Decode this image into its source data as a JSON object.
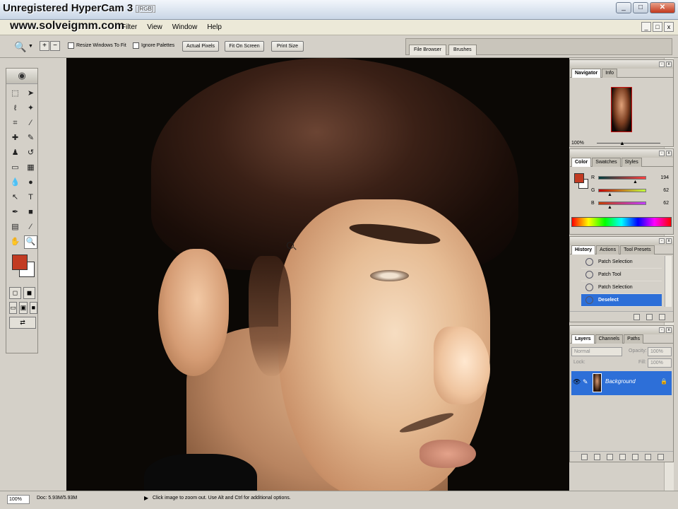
{
  "window": {
    "title": "Unregistered HyperCam 3",
    "mode": "[RGB]",
    "watermark": "www.solveigmm.com",
    "buttons": [
      "_",
      "□",
      "✕"
    ]
  },
  "menubar": {
    "items": [
      "Filter",
      "View",
      "Window",
      "Help"
    ],
    "doc_buttons": [
      "_",
      "□",
      "x"
    ]
  },
  "options_bar": {
    "tool_icon": "zoom-icon",
    "checkbox_resize": "Resize Windows To Fit",
    "checkbox_ignore": "Ignore Palettes",
    "btn_actual": "Actual Pixels",
    "btn_fit": "Fit On Screen",
    "btn_print": "Print Size",
    "palette_tabs": [
      "File Browser",
      "Brushes"
    ]
  },
  "navigator": {
    "tabs": [
      "Navigator",
      "Info"
    ],
    "zoom": "100%"
  },
  "color": {
    "tabs": [
      "Color",
      "Swatches",
      "Styles"
    ],
    "fg_color": "#c23b22",
    "bg_color": "#ffffff",
    "channels": [
      {
        "label": "R",
        "value": "194",
        "gradient": "linear-gradient(to right, #003e3e, #ff3e3e)",
        "pos": 0.76
      },
      {
        "label": "G",
        "value": "62",
        "gradient": "linear-gradient(to right, #c20000, #c2ff3e)",
        "pos": 0.24
      },
      {
        "label": "B",
        "value": "62",
        "gradient": "linear-gradient(to right, #c23e00, #c23eff)",
        "pos": 0.24
      }
    ]
  },
  "history": {
    "tabs": [
      "History",
      "Actions",
      "Tool Presets"
    ],
    "items": [
      "Patch Selection",
      "Patch Tool",
      "Patch Selection",
      "Deselect"
    ],
    "selected_index": 3
  },
  "layers": {
    "tabs": [
      "Layers",
      "Channels",
      "Paths"
    ],
    "blend_mode": "Normal",
    "opacity_label": "Opacity:",
    "opacity": "100%",
    "lock_label": "Lock:",
    "fill_label": "Fill:",
    "fill": "100%",
    "layer_name": "Background"
  },
  "status": {
    "zoom": "100%",
    "doc": "Doc: 5.93M/5.93M",
    "hint": "Click image to zoom out. Use Alt and Ctrl for additional options."
  }
}
